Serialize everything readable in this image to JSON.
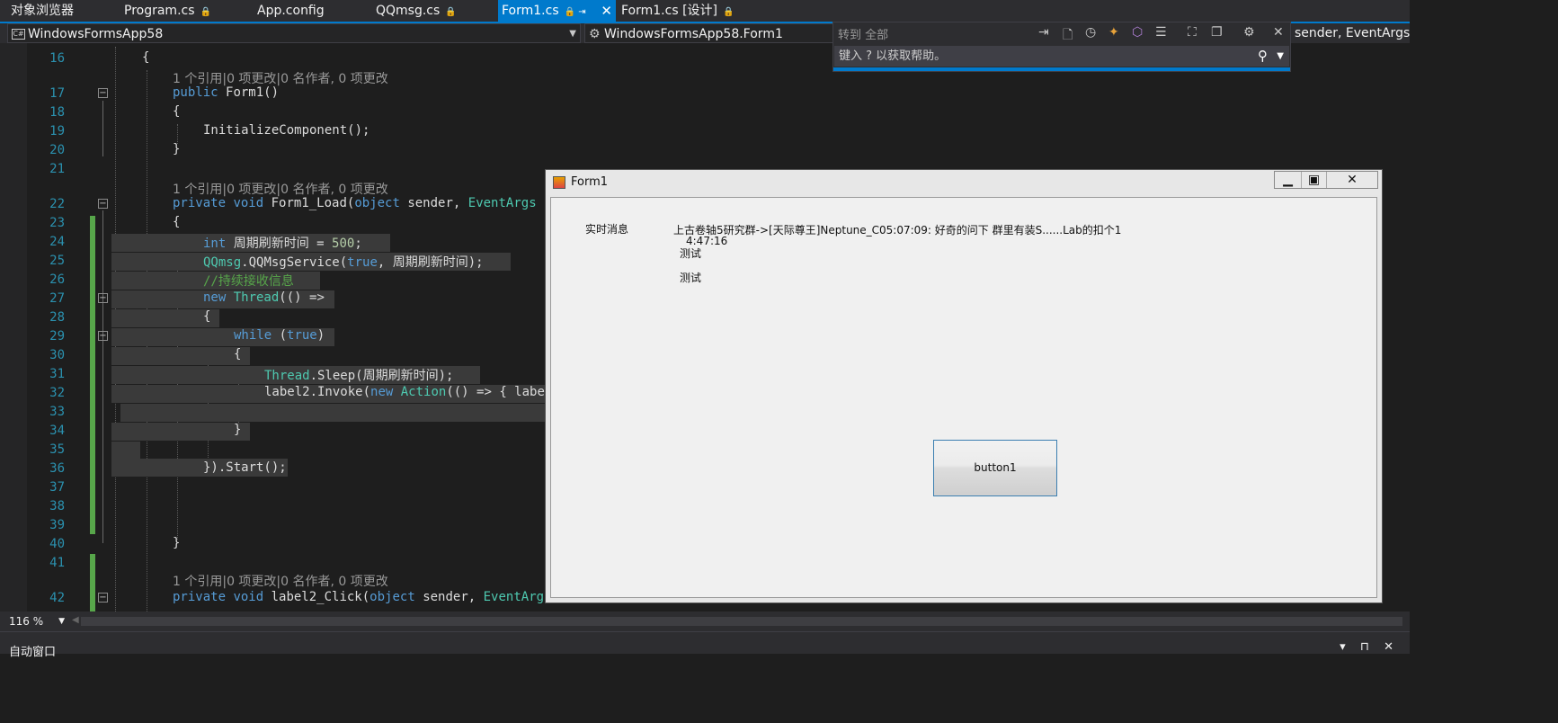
{
  "tabs": [
    {
      "label": "对象浏览器"
    },
    {
      "label": "Program.cs",
      "pin": "🔒"
    },
    {
      "label": "App.config"
    },
    {
      "label": "QQmsg.cs",
      "pin": "🔒"
    },
    {
      "label": "Form1.cs",
      "pin": "🔒 ⇥",
      "close": "✕"
    },
    {
      "label": "Form1.cs [设计]",
      "pin": "🔒"
    }
  ],
  "nav": {
    "project": "WindowsFormsApp58",
    "project_icon": "C#",
    "class_icon": "class-icon",
    "class": "WindowsFormsApp58.Form1",
    "member": "t sender, EventArgs"
  },
  "quick": {
    "goto_label": "转到 全部",
    "help_placeholder": "键入 ? 以获取帮助。",
    "icons": [
      "line-icon",
      "file-icon",
      "clock-icon",
      "symbol-icon",
      "cube-icon",
      "list-icon",
      "expand-icon",
      "copy-icon",
      "gear-icon",
      "close-icon"
    ],
    "search_icon": "search-icon"
  },
  "editor": {
    "line_numbers": [
      "16",
      "17",
      "18",
      "19",
      "20",
      "21",
      "22",
      "23",
      "24",
      "25",
      "26",
      "27",
      "28",
      "29",
      "30",
      "31",
      "32",
      "33",
      "34",
      "35",
      "36",
      "37",
      "38",
      "39",
      "40",
      "41",
      "42"
    ],
    "codelens": [
      "1 个引用|0 项更改|0 名作者, 0 项更改",
      "1 个引用|0 项更改|0 名作者, 0 项更改",
      "1 个引用|0 项更改|0 名作者, 0 项更改"
    ],
    "code": [
      [
        "{"
      ],
      [
        "public ",
        "Form1()"
      ],
      [
        "{"
      ],
      [
        "InitializeComponent();"
      ],
      [
        "}"
      ],
      [
        "private ",
        "void ",
        "Form1_Load(",
        "object ",
        "sender, ",
        "EventArgs"
      ],
      [
        "{"
      ],
      [
        "int ",
        "周期刷新时间 = ",
        "500",
        ";"
      ],
      [
        "QQmsg",
        ".QQMsgService(",
        "true",
        ", 周期刷新时间);"
      ],
      [
        "//持续接收信息"
      ],
      [
        "new ",
        "Thread",
        "(() =>"
      ],
      [
        "{"
      ],
      [
        "while ",
        "(",
        "true",
        ")"
      ],
      [
        "{"
      ],
      [
        "Thread",
        ".Sleep(周期刷新时间);"
      ],
      [
        "label2.Invoke(",
        "new ",
        "Action",
        "(() => { labe"
      ],
      [
        "}"
      ],
      [
        "}).Start();"
      ],
      [
        "}"
      ],
      [
        "private ",
        "void ",
        "label2_Click(",
        "object ",
        "sender, ",
        "EventArgs"
      ]
    ]
  },
  "form": {
    "title": "Form1",
    "min": "▁",
    "max": "▣",
    "close": "✕",
    "labels": [
      "实时消息",
      "上古卷轴5研究群->[天际尊王]Neptune_C05:07:09: 好奇的问下 群里有装S......Lab的扣个1",
      "4:47:16",
      "测试",
      "测试"
    ],
    "button": "button1"
  },
  "status": {
    "zoom": "116 %",
    "output_title": "自动窗口",
    "output_icons": "▾ ⊓ ✕"
  }
}
